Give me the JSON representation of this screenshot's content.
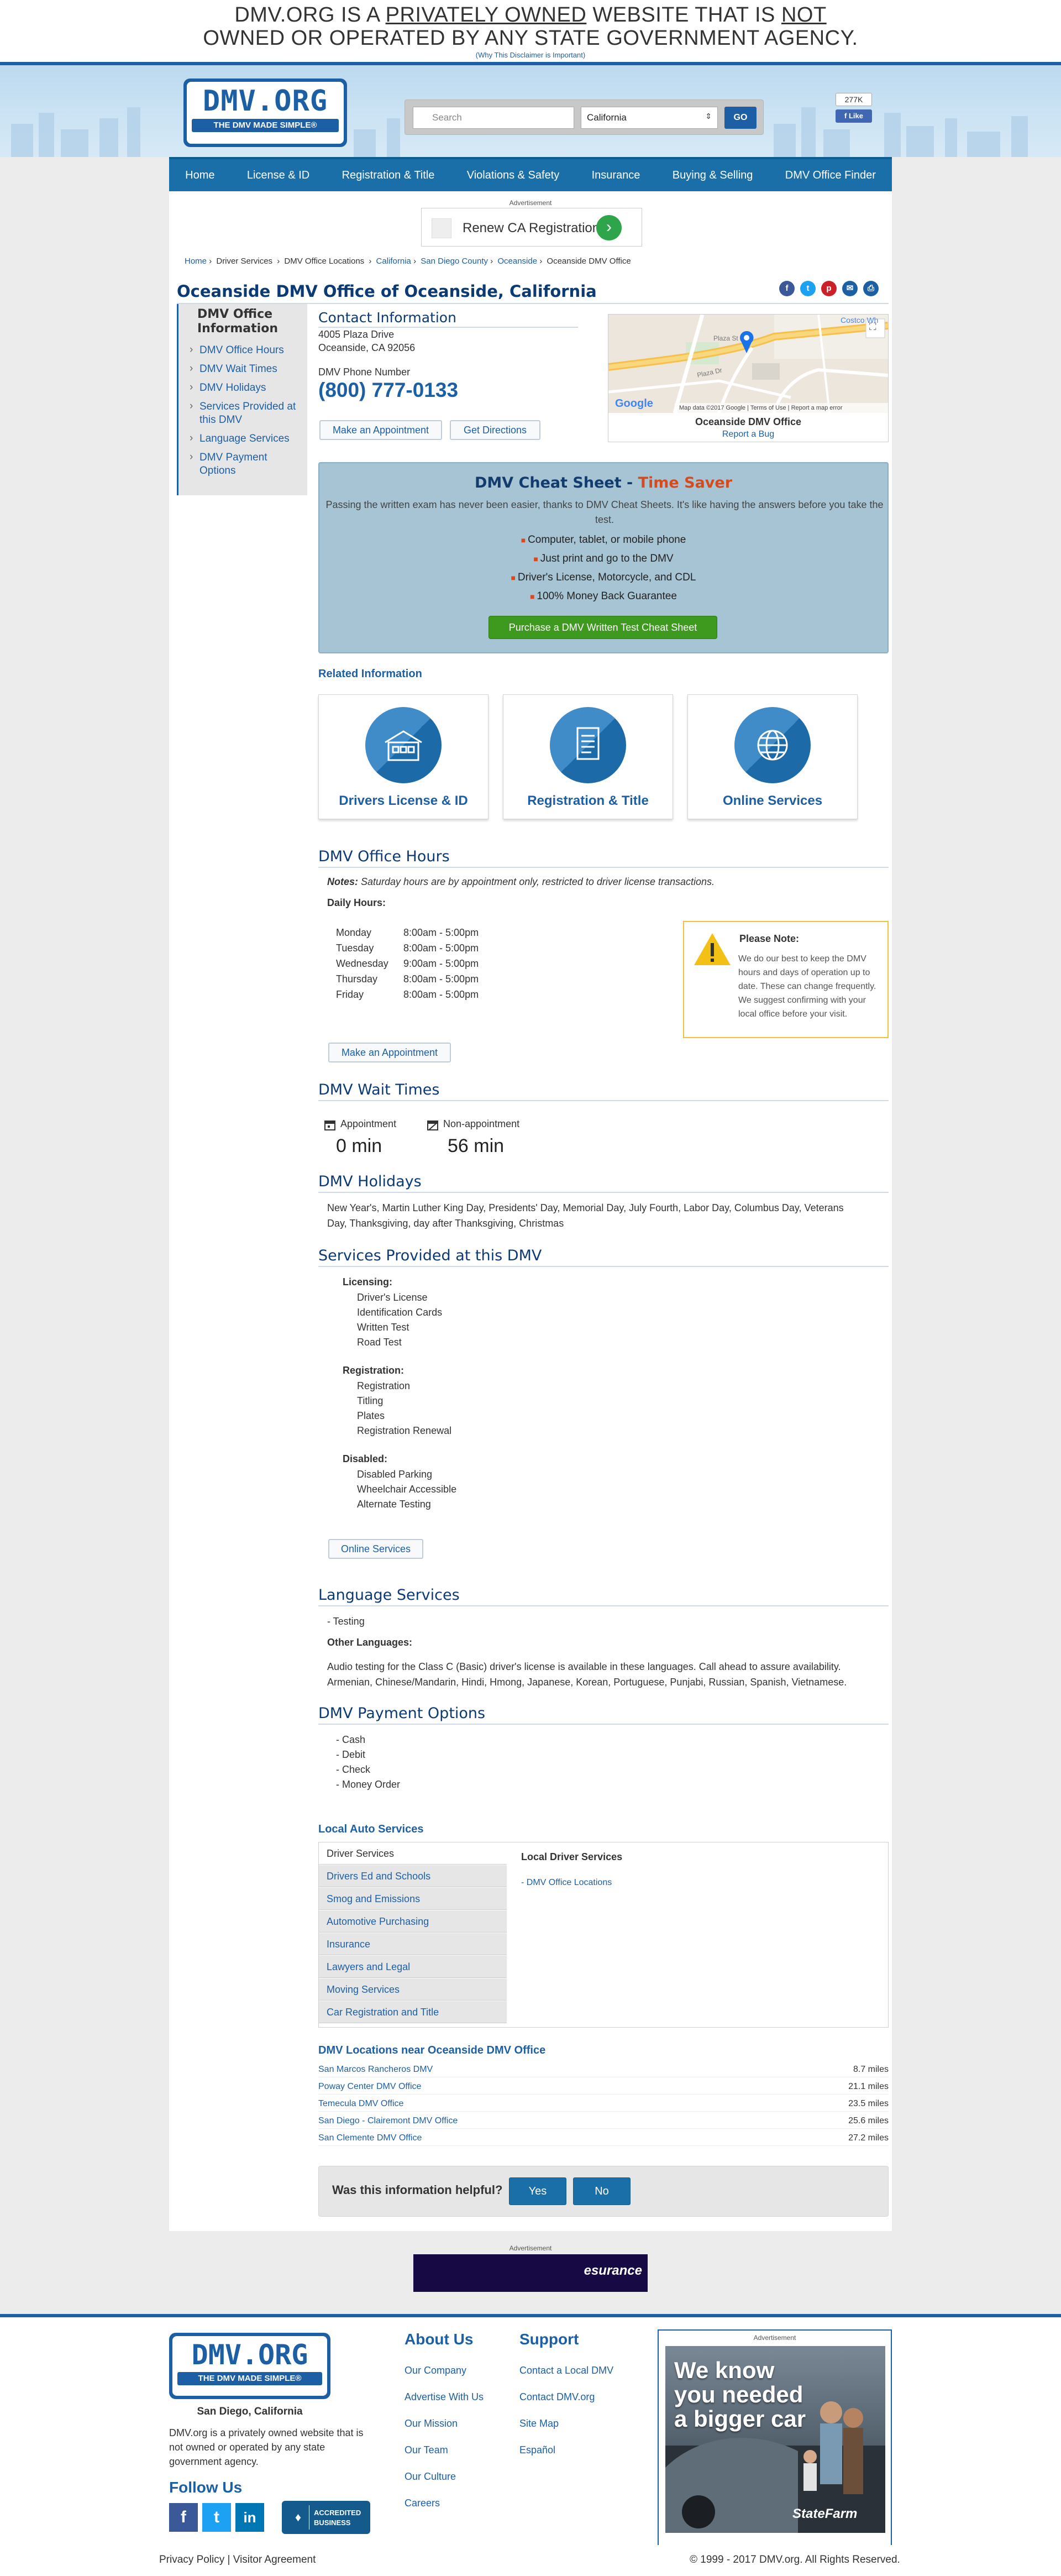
{
  "disclaimer": {
    "line1_pre": "DMV.ORG IS A ",
    "line1_u1": "PRIVATELY OWNED",
    "line1_mid": " WEBSITE THAT IS ",
    "line1_u2": "NOT",
    "line2": "OWNED OR OPERATED BY ANY STATE GOVERNMENT AGENCY.",
    "why_link": "(Why This Disclaimer is Important)"
  },
  "header": {
    "logo_text": "DMV.ORG",
    "logo_tagline": "THE DMV MADE SIMPLE®",
    "search_placeholder": "Search",
    "state_selected": "California",
    "go_label": "GO",
    "fb_count": "277K",
    "fb_like": "Like"
  },
  "nav": [
    "Home",
    "License & ID",
    "Registration & Title",
    "Violations & Safety",
    "Insurance",
    "Buying & Selling",
    "DMV Office Finder"
  ],
  "ads": {
    "label": "Advertisement",
    "top_text": "Renew CA Registration",
    "bottom_brand": "esurance"
  },
  "breadcrumb": [
    "Home",
    "Driver Services",
    "DMV Office Locations",
    "California",
    "San Diego County",
    "Oceanside",
    "Oceanside DMV Office"
  ],
  "page_title": "Oceanside DMV Office of Oceanside, California",
  "sidebar": {
    "heading": "DMV Office Information",
    "items": [
      "DMV Office Hours",
      "DMV Wait Times",
      "DMV Holidays",
      "Services Provided at this DMV",
      "Language Services",
      "DMV Payment Options"
    ]
  },
  "contact": {
    "heading": "Contact Information",
    "address1": "4005 Plaza Drive",
    "address2": "Oceanside, CA 92056",
    "phone_label": "DMV Phone Number",
    "phone": "(800) 777-0133",
    "appointment_button": "Make an Appointment",
    "directions_button": "Get Directions"
  },
  "map": {
    "title": "Oceanside DMV Office",
    "report_bug": "Report a Bug",
    "attribution": "Map data ©2017 Google",
    "terms": "Terms of Use",
    "report_error": "Report a map error",
    "google": "Google",
    "poi": "Costco Wh",
    "street1": "Plaza Dr",
    "street2": "Plaza St"
  },
  "cheat_sheet": {
    "title": "DMV Cheat Sheet - ",
    "title_highlight": "Time Saver",
    "intro": "Passing the written exam has never been easier, thanks to DMV Cheat Sheets. It's like having the answers before you take the test.",
    "bullets": [
      "Computer, tablet, or mobile phone",
      "Just print and go to the DMV",
      "Driver's License, Motorcycle, and CDL",
      "100% Money Back Guarantee"
    ],
    "button": "Purchase a DMV Written Test Cheat Sheet"
  },
  "related": {
    "heading": "Related Information",
    "cards": [
      "Drivers License & ID",
      "Registration & Title",
      "Online Services"
    ]
  },
  "hours": {
    "heading": "DMV Office Hours",
    "notes_label": "Notes:",
    "notes_text": " Saturday hours are by appointment only, restricted to driver license transactions.",
    "daily_label": "Daily Hours:",
    "days": [
      {
        "day": "Monday",
        "time": "8:00am - 5:00pm"
      },
      {
        "day": "Tuesday",
        "time": "8:00am - 5:00pm"
      },
      {
        "day": "Wednesday",
        "time": "9:00am - 5:00pm"
      },
      {
        "day": "Thursday",
        "time": "8:00am - 5:00pm"
      },
      {
        "day": "Friday",
        "time": "8:00am - 5:00pm"
      }
    ],
    "note_title": "Please Note:",
    "note_text": "We do our best to keep the DMV hours and days of operation up to date. These can change frequently. We suggest confirming with your local office before your visit.",
    "appointment_button": "Make an Appointment"
  },
  "wait_times": {
    "heading": "DMV Wait Times",
    "appointment_label": "Appointment",
    "appointment_value": "0 min",
    "nonappointment_label": "Non-appointment",
    "nonappointment_value": "56 min"
  },
  "holidays": {
    "heading": "DMV Holidays",
    "line1": "New Year's, Martin Luther King Day, Presidents' Day, Memorial Day, July Fourth, Labor Day, Columbus Day, Veterans",
    "line2": "Day, Thanksgiving, day after Thanksgiving, Christmas"
  },
  "services": {
    "heading": "Services Provided at this DMV",
    "licensing_label": "Licensing:",
    "licensing": [
      "Driver's License",
      "Identification Cards",
      "Written Test",
      "Road Test"
    ],
    "registration_label": "Registration:",
    "registration": [
      "Registration",
      "Titling",
      "Plates",
      "Registration Renewal"
    ],
    "disabled_label": "Disabled:",
    "disabled": [
      "Disabled Parking",
      "Wheelchair Accessible",
      "Alternate Testing"
    ],
    "online_button": "Online Services"
  },
  "language": {
    "heading": "Language Services",
    "testing": "- Testing",
    "other_label": "Other Languages:",
    "line1": "Audio testing for the Class C (Basic) driver's license is available in these languages. Call ahead to assure availability.",
    "line2": "Armenian, Chinese/Mandarin, Hindi, Hmong, Japanese, Korean, Portuguese, Punjabi, Russian, Spanish, Vietnamese."
  },
  "payment": {
    "heading": "DMV Payment Options",
    "items": [
      "- Cash",
      "- Debit",
      "- Check",
      "- Money Order"
    ]
  },
  "local_auto": {
    "heading": "Local Auto Services",
    "tabs": [
      "Driver Services",
      "Drivers Ed and Schools",
      "Smog and Emissions",
      "Automotive Purchasing",
      "Insurance",
      "Lawyers and Legal",
      "Moving Services",
      "Car Registration and Title"
    ],
    "panel_heading": "Local Driver Services",
    "panel_link": "- DMV Office Locations"
  },
  "nearby": {
    "heading": "DMV Locations near Oceanside DMV Office",
    "items": [
      {
        "name": "San Marcos Rancheros DMV",
        "dist": "8.7 miles"
      },
      {
        "name": "Poway Center DMV Office",
        "dist": "21.1 miles"
      },
      {
        "name": "Temecula DMV Office",
        "dist": "23.5 miles"
      },
      {
        "name": "San Diego - Clairemont DMV Office",
        "dist": "25.6 miles"
      },
      {
        "name": "San Clemente DMV Office",
        "dist": "27.2 miles"
      }
    ]
  },
  "helpful": {
    "question": "Was this information helpful?",
    "yes": "Yes",
    "no": "No"
  },
  "footer": {
    "location": "San Diego, California",
    "blurb": [
      "DMV.org is a privately owned website that is",
      "not owned or operated by any state",
      "government agency."
    ],
    "follow": "Follow Us",
    "about_heading": "About Us",
    "about_links": [
      "Our Company",
      "Advertise With Us",
      "Our Mission",
      "Our Team",
      "Our Culture",
      "Careers"
    ],
    "support_heading": "Support",
    "support_links": [
      "Contact a Local DMV",
      "Contact DMV.org",
      "Site Map",
      "Español"
    ],
    "bbb_line1": "ACCREDITED",
    "bbb_line2": "BUSINESS",
    "ad_headline": [
      "We know",
      "you needed",
      "a bigger car"
    ],
    "ad_brand": "StateFarm",
    "privacy": "Privacy Policy",
    "visitor": "Visitor Agreement",
    "separator": " | ",
    "copyright": "© 1999 - 2017 DMV.org. All Rights Reserved."
  },
  "colors": {
    "brand": "#1d5fa4",
    "nav": "#1b6fa8",
    "accent": "#d84a1b",
    "cta_green": "#3d9a1e",
    "note_border": "#f0c23a"
  }
}
